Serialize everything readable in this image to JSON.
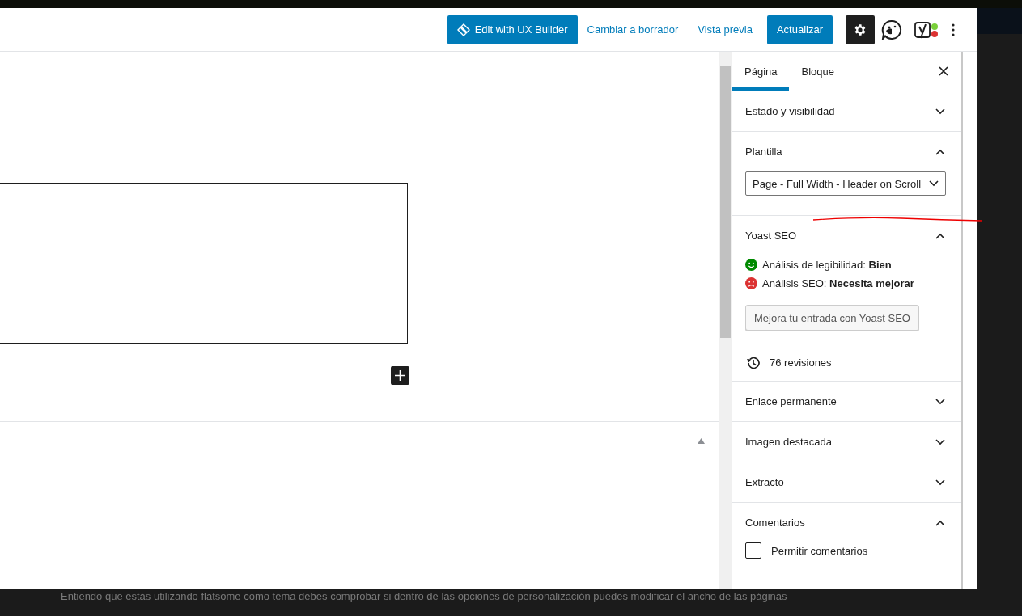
{
  "header": {
    "ux_builder_button": "Edit with UX Builder",
    "draft_link": "Cambiar a borrador",
    "preview_link": "Vista previa",
    "update_button": "Actualizar",
    "settings_selected": true
  },
  "sidebar": {
    "tabs": [
      {
        "label": "Página",
        "selected": true
      },
      {
        "label": "Bloque",
        "selected": false
      }
    ],
    "panels": [
      {
        "kind": "panel",
        "title": "Estado y visibilidad",
        "expanded": false
      },
      {
        "kind": "panel",
        "title": "Plantilla",
        "expanded": true,
        "select": {
          "value": "Page - Full Width - Header on Scroll"
        }
      },
      {
        "kind": "panel",
        "title": "Yoast SEO",
        "expanded": true,
        "analyses": [
          {
            "kind": "good",
            "label": "Análisis de legibilidad:",
            "result": "Bien",
            "color": "#008a00"
          },
          {
            "kind": "bad",
            "label": "Análisis SEO:",
            "result": "Necesita mejorar",
            "color": "#dc3232"
          }
        ],
        "button": "Mejora tu entrada con Yoast SEO"
      },
      {
        "kind": "revisions",
        "label": "76 revisiones"
      },
      {
        "kind": "panel",
        "title": "Enlace permanente",
        "expanded": false
      },
      {
        "kind": "panel",
        "title": "Imagen destacada",
        "expanded": false
      },
      {
        "kind": "panel",
        "title": "Extracto",
        "expanded": false
      },
      {
        "kind": "panel",
        "title": "Comentarios",
        "expanded": true,
        "checkbox": {
          "label": "Permitir comentarios",
          "checked": false
        }
      }
    ]
  },
  "comment_text": "Entiendo que estás utilizando flatsome como tema debes comprobar si dentro de las opciones de personalización puedes modificar el ancho de las páginas"
}
